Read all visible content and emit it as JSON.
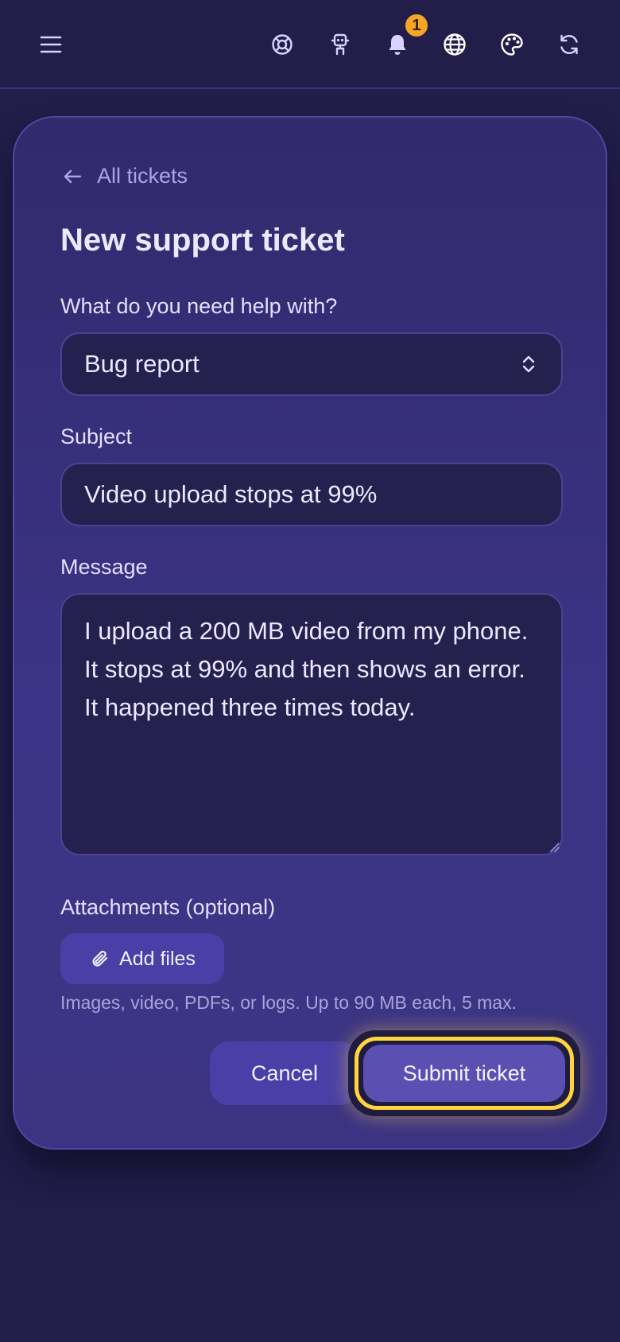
{
  "topbar": {
    "icons": [
      "menu-icon",
      "lifebuoy-icon",
      "robot-icon",
      "bell-icon",
      "globe-icon",
      "palette-icon",
      "refresh-icon"
    ],
    "notification_count": "1"
  },
  "form": {
    "back_link": "All tickets",
    "title": "New support ticket",
    "topic_label": "What do you need help with?",
    "topic_value": "Bug report",
    "subject_label": "Subject",
    "subject_value": "Video upload stops at 99%",
    "message_label": "Message",
    "message_value": "I upload a 200 MB video from my phone. It stops at 99% and then shows an error. It happened three times today.",
    "attachments_label": "Attachments (optional)",
    "add_files_label": "Add files",
    "attachments_help": "Images, video, PDFs, or logs. Up to 90 MB each, 5 max.",
    "cancel_label": "Cancel",
    "submit_label": "Submit ticket"
  },
  "colors": {
    "background": "#221d49",
    "card": "#3b3385",
    "input": "#25204d",
    "button": "#4a3fa6",
    "focus_ring": "#ffd43c",
    "badge": "#f5a623"
  }
}
